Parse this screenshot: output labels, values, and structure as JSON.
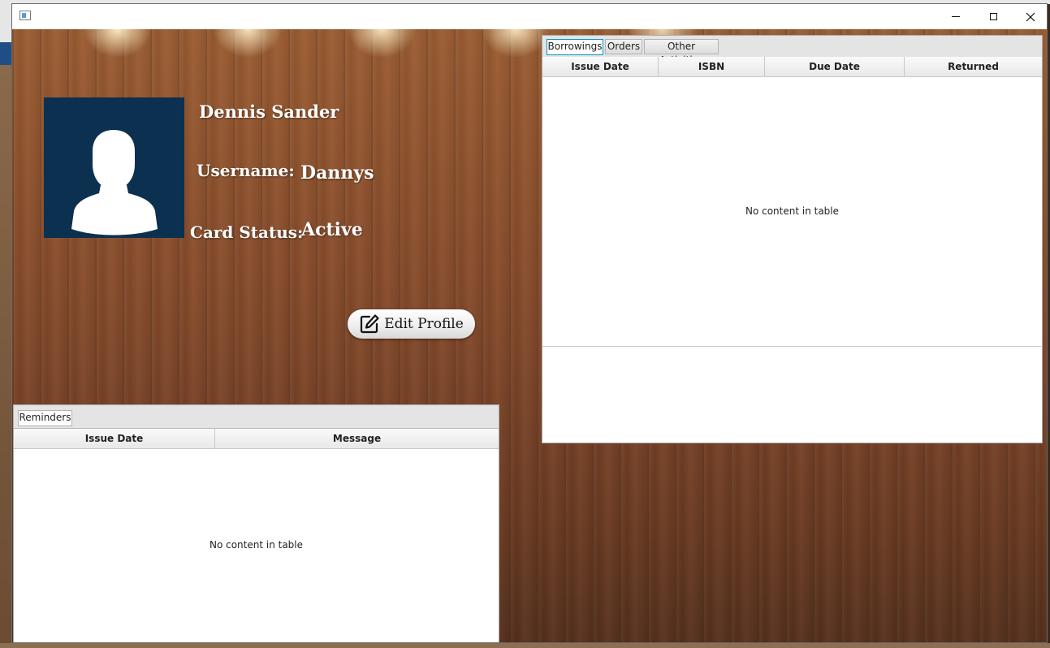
{
  "window": {
    "app_icon": "app-window-icon",
    "controls": [
      "minimize-icon",
      "maximize-icon",
      "close-icon"
    ]
  },
  "profile": {
    "avatar_icon": "user-silhouette-icon",
    "name": "Dennis Sander",
    "username_label": "Username:",
    "username_value": "Dannys",
    "card_status_label": "Card Status:",
    "card_status_value": "Active",
    "edit_button_label": "Edit Profile",
    "edit_button_icon": "edit-pencil-icon"
  },
  "activity_pane": {
    "tabs": [
      "Borrowings",
      "Orders",
      "Other Activities"
    ],
    "active_tab": "Borrowings",
    "columns": [
      "Issue Date",
      "ISBN",
      "Due Date",
      "Returned"
    ],
    "empty_message": "No content in table"
  },
  "reminders_pane": {
    "tabs": [
      "Reminders"
    ],
    "columns": [
      "Issue Date",
      "Message"
    ],
    "empty_message": "No content in table"
  },
  "colors": {
    "avatar_bg": "#0c3050",
    "active_tab_border": "#0096c9",
    "wood": "#84492a"
  }
}
